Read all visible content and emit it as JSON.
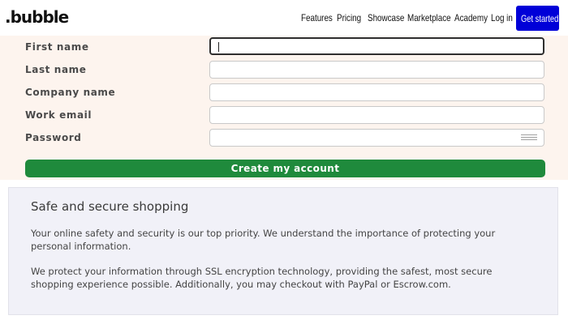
{
  "header": {
    "logo": ".bubble",
    "nav": [
      "Features",
      "Pricing",
      "Showcase",
      "Marketplace",
      "Academy",
      "Log in"
    ],
    "cta": "Get started",
    "cta_color": "#0000d8"
  },
  "form": {
    "fields": [
      {
        "label": "First name",
        "value": "",
        "focused": true
      },
      {
        "label": "Last name",
        "value": ""
      },
      {
        "label": "Company name",
        "value": ""
      },
      {
        "label": "Work email",
        "value": ""
      },
      {
        "label": "Password",
        "value": "",
        "icon": "password-manager-icon"
      }
    ],
    "submit_label": "Create my account",
    "submit_color": "#1f8a3c",
    "background_color": "#fdf4ee"
  },
  "info": {
    "title": "Safe and secure shopping",
    "paragraph1": "Your online safety and security is our top priority. We understand the importance of protecting your personal information.",
    "paragraph2": "We protect your information through SSL encryption technology, providing the safest, most secure shopping experience possible. Additionally, you may checkout with PayPal or Escrow.com."
  }
}
